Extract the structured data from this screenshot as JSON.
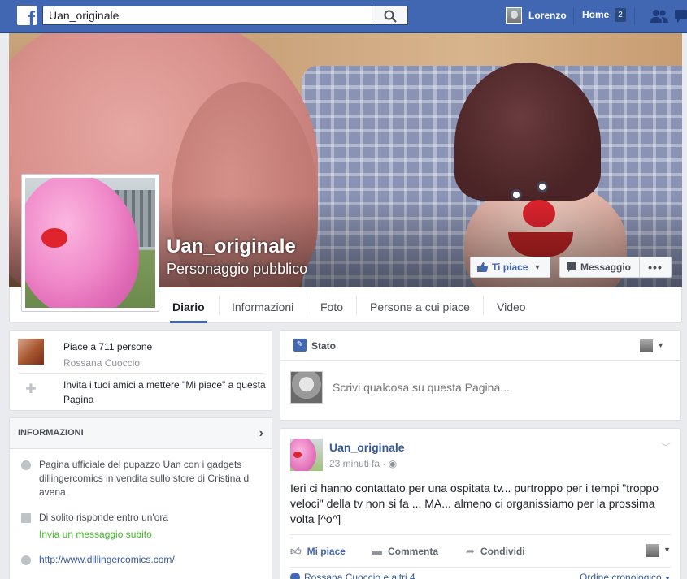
{
  "topbar": {
    "search_value": "Uan_originale",
    "user_name": "Lorenzo",
    "home_label": "Home",
    "home_count": "2"
  },
  "cover": {
    "page_name": "Uan_originale",
    "category": "Personaggio pubblico",
    "like_button": "Ti piace",
    "message_button": "Messaggio",
    "more_button": "•••"
  },
  "nav": {
    "tabs": [
      "Diario",
      "Informazioni",
      "Foto",
      "Persone a cui piace",
      "Video"
    ]
  },
  "likes": {
    "count_text": "Piace a 711 persone",
    "friend_name": "Rossana Cuoccio",
    "invite_text": "Invita i tuoi amici a mettere \"Mi piace\" a questa Pagina"
  },
  "info": {
    "header": "INFORMAZIONI",
    "description": "Pagina ufficiale del pupazzo Uan con i gadgets dillingercomics in vendita sullo store di Cristina d avena",
    "response": "Di solito risponde entro un'ora",
    "message_link": "Invia un messaggio subito",
    "website": "http://www.dillingercomics.com/"
  },
  "status": {
    "header": "Stato",
    "placeholder": "Scrivi qualcosa su questa Pagina..."
  },
  "post": {
    "author": "Uan_originale",
    "time": "23 minuti fa",
    "text": "Ieri ci hanno contattato per una ospitata tv... purtroppo per i tempi \"troppo veloci\" della tv non si fa ... MA... almeno ci organissiamo per la prossima volta [^o^]",
    "like_action": "Mi piace",
    "comment_action": "Commenta",
    "share_action": "Condividi",
    "liked_by": "Rossana Cuoccio e altri 4",
    "order": "Ordine cronologico"
  },
  "colors": {
    "brand_blue": "#4267b2",
    "link_blue": "#365899",
    "green": "#42b72a"
  }
}
